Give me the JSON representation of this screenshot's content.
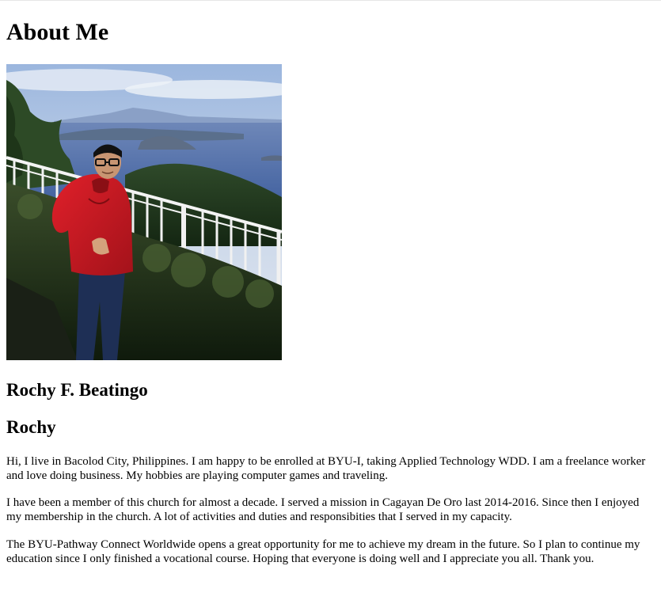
{
  "page": {
    "heading": "About Me",
    "photo_alt": "Rochy standing by a white railing with a lake and volcano view"
  },
  "profile": {
    "full_name": "Rochy F. Beatingo",
    "nickname": "Rochy"
  },
  "bio": {
    "paragraphs": [
      "Hi, I live in Bacolod City, Philippines. I am happy to be enrolled at BYU-I, taking Applied Technology WDD. I am a freelance worker and love doing business. My hobbies are playing computer games and traveling.",
      "I have been a member of this church for almost a decade. I served a mission in Cagayan De Oro last 2014-2016. Since then I enjoyed my membership in the church. A lot of activities and duties and responsibities that I served in my capacity.",
      "The BYU-Pathway Connect Worldwide opens a great opportunity for me to achieve my dream in the future. So I plan to continue my education since I only finished a vocational course. Hoping that everyone is doing well and I appreciate you all. Thank you."
    ]
  }
}
